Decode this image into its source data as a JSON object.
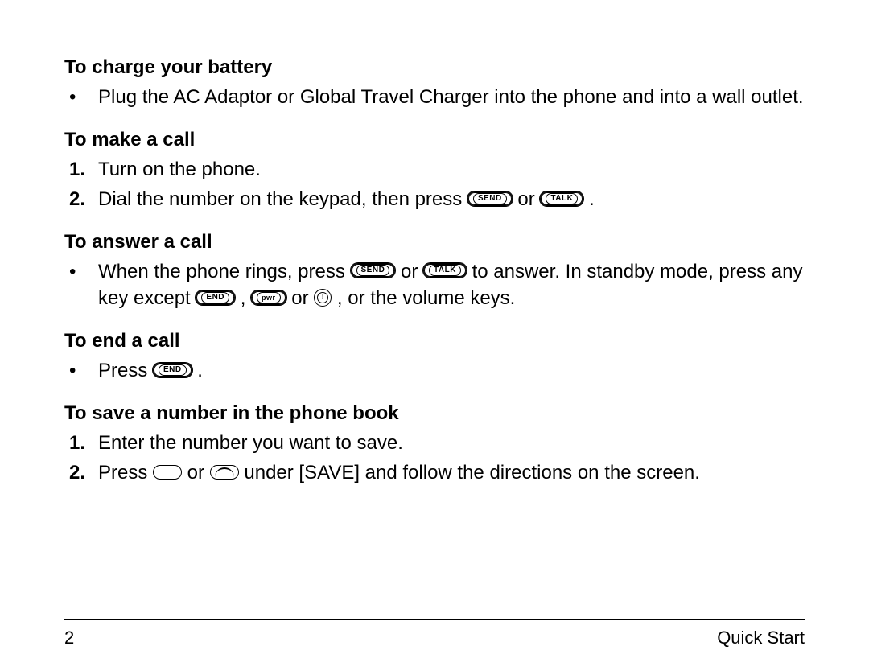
{
  "sections": [
    {
      "heading": "To charge your battery",
      "items": [
        {
          "marker": "•",
          "type": "bullet",
          "segments": [
            {
              "kind": "text",
              "value": "Plug the AC Adaptor or Global Travel Charger into the phone and into a wall outlet."
            }
          ]
        }
      ]
    },
    {
      "heading": "To make a call",
      "items": [
        {
          "marker": "1.",
          "type": "num",
          "segments": [
            {
              "kind": "text",
              "value": "Turn on the phone."
            }
          ]
        },
        {
          "marker": "2.",
          "type": "num",
          "segments": [
            {
              "kind": "text",
              "value": "Dial the number on the keypad, then press "
            },
            {
              "kind": "pill",
              "label": "SEND",
              "name": "send-button-icon"
            },
            {
              "kind": "text",
              "value": " or "
            },
            {
              "kind": "pill",
              "label": "TALK",
              "name": "talk-button-icon"
            },
            {
              "kind": "text",
              "value": " ."
            }
          ]
        }
      ]
    },
    {
      "heading": "To answer a call",
      "items": [
        {
          "marker": "•",
          "type": "bullet",
          "segments": [
            {
              "kind": "text",
              "value": "When the phone rings, press "
            },
            {
              "kind": "pill",
              "label": "SEND",
              "name": "send-button-icon"
            },
            {
              "kind": "text",
              "value": " or "
            },
            {
              "kind": "pill",
              "label": "TALK",
              "name": "talk-button-icon"
            },
            {
              "kind": "text",
              "value": " to answer. In standby mode, press any key except "
            },
            {
              "kind": "pill",
              "label": "END",
              "name": "end-button-icon"
            },
            {
              "kind": "text",
              "value": " , "
            },
            {
              "kind": "pill",
              "label": "pwr",
              "name": "pwr-button-icon",
              "small": true
            },
            {
              "kind": "text",
              "value": " or "
            },
            {
              "kind": "circle",
              "label": "!",
              "name": "info-button-icon"
            },
            {
              "kind": "text",
              "value": " , or the volume keys."
            }
          ]
        }
      ]
    },
    {
      "heading": "To end a call",
      "items": [
        {
          "marker": "•",
          "type": "bullet",
          "segments": [
            {
              "kind": "text",
              "value": "Press "
            },
            {
              "kind": "pill",
              "label": "END",
              "name": "end-button-icon"
            },
            {
              "kind": "text",
              "value": " ."
            }
          ]
        }
      ]
    },
    {
      "heading": "To save a number in the phone book",
      "items": [
        {
          "marker": "1.",
          "type": "num",
          "segments": [
            {
              "kind": "text",
              "value": "Enter the number you want to save."
            }
          ]
        },
        {
          "marker": "2.",
          "type": "num",
          "segments": [
            {
              "kind": "text",
              "value": "Press "
            },
            {
              "kind": "softkey",
              "variant": "plain",
              "name": "softkey-plain-icon"
            },
            {
              "kind": "text",
              "value": " or "
            },
            {
              "kind": "softkey",
              "variant": "arc",
              "name": "softkey-arc-icon"
            },
            {
              "kind": "text",
              "value": " under [SAVE] and follow the directions on the screen."
            }
          ]
        }
      ]
    }
  ],
  "footer": {
    "page_number": "2",
    "title": "Quick Start"
  }
}
